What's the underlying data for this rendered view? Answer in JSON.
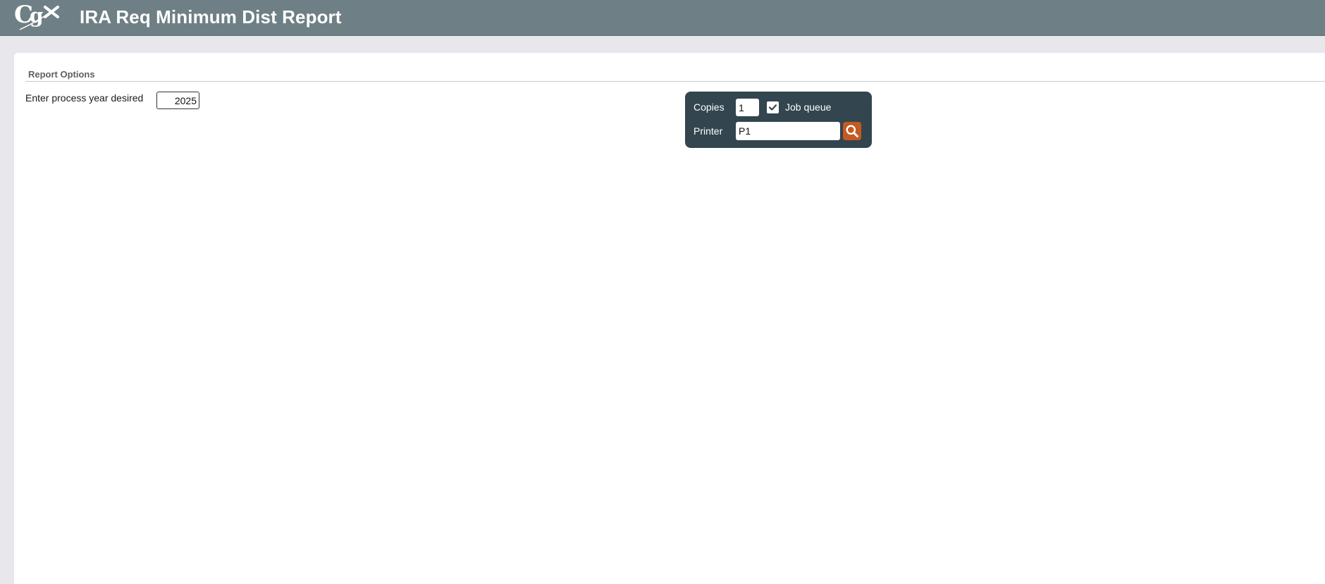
{
  "header": {
    "title": "IRA Req Minimum Dist Report",
    "logo_icon": "cgx-logo",
    "background_color": "#6e8085"
  },
  "report_options": {
    "section_title": "Report Options",
    "year_label": "Enter process year desired",
    "year_value": "2025"
  },
  "print_options": {
    "copies_label": "Copies",
    "copies_value": "1",
    "job_queue_label": "Job queue",
    "job_queue_checked": true,
    "printer_label": "Printer",
    "printer_value": "P1",
    "search_icon": "search-icon",
    "panel_color": "#33454f",
    "accent_color": "#c55a21"
  }
}
